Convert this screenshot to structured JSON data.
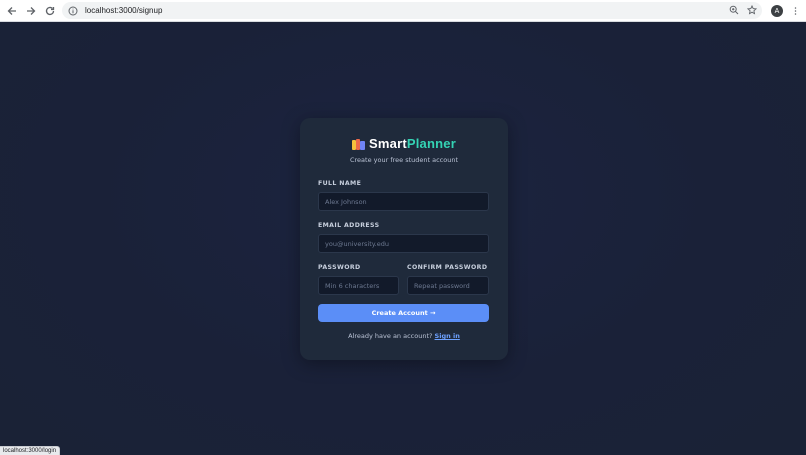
{
  "browser": {
    "url": "localhost:3000/signup",
    "profile_initial": "A",
    "status_url": "localhost:3000/login"
  },
  "brand": {
    "name_part1": "Smart",
    "name_part2": "Planner",
    "subtitle": "Create your free student account",
    "colors": {
      "accent": "#34d3b4",
      "button": "#5b8ef7",
      "link": "#6da1ff"
    }
  },
  "form": {
    "full_name": {
      "label": "FULL NAME",
      "placeholder": "Alex Johnson",
      "value": ""
    },
    "email": {
      "label": "EMAIL ADDRESS",
      "placeholder": "you@university.edu",
      "value": ""
    },
    "password": {
      "label": "PASSWORD",
      "placeholder": "Min 6 characters",
      "value": ""
    },
    "confirm_password": {
      "label": "CONFIRM PASSWORD",
      "placeholder": "Repeat password",
      "value": ""
    },
    "submit_label": "Create Account →",
    "signin_prompt": "Already have an account?",
    "signin_link": "Sign in"
  },
  "icons": [
    "back-arrow-icon",
    "forward-arrow-icon",
    "reload-icon",
    "site-info-icon",
    "zoom-icon",
    "star-icon",
    "more-vert-icon",
    "books-logo-icon"
  ]
}
